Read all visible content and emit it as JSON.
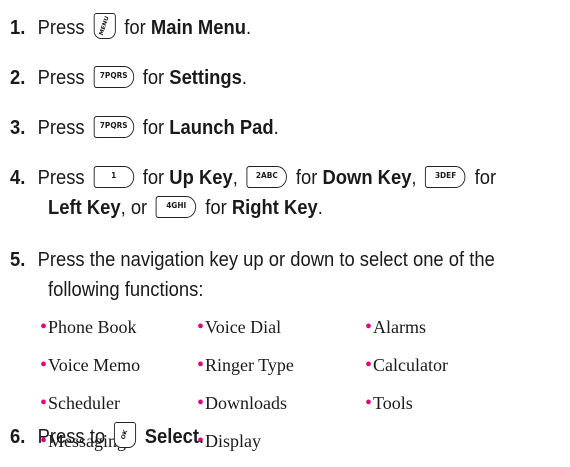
{
  "steps": [
    {
      "num": "1.",
      "pre": "Press",
      "mid": "for",
      "bold": "Main Menu",
      "end": ".",
      "key": "MENU"
    },
    {
      "num": "2.",
      "pre": "Press",
      "mid": "for",
      "bold": "Settings",
      "end": ".",
      "key": "7PQRS"
    },
    {
      "num": "3.",
      "pre": "Press",
      "mid": "for",
      "bold": "Launch Pad",
      "end": ".",
      "key": "7PQRS"
    },
    {
      "num": "4.",
      "pre": "Press",
      "k1": "1",
      "t1": "for",
      "b1": "Up Key",
      "sep1": ",",
      "k2": "2ABC",
      "t2": "for",
      "b2": "Down Key",
      "sep2": ",",
      "k3": "3DEF",
      "t3": "for",
      "b3": "Left Key",
      "or": ", or",
      "k4": "4GHI",
      "t4": "for",
      "b4": "Right Key",
      "end": "."
    },
    {
      "num": "5.",
      "line1": "Press the navigation key up or down to select one of the",
      "line2": "following functions:"
    },
    {
      "num": "6.",
      "pre": "Press to",
      "bold": "Select",
      "end": ".",
      "key": "OK"
    }
  ],
  "functions": [
    [
      "Phone Book",
      "Voice Dial",
      "Alarms"
    ],
    [
      "Voice Memo",
      "Ringer Type",
      "Calculator"
    ],
    [
      "Scheduler",
      "Downloads",
      "Tools"
    ],
    [
      "Messaging",
      "Display",
      ""
    ]
  ],
  "colors": {
    "bullet": "#e6007e"
  }
}
